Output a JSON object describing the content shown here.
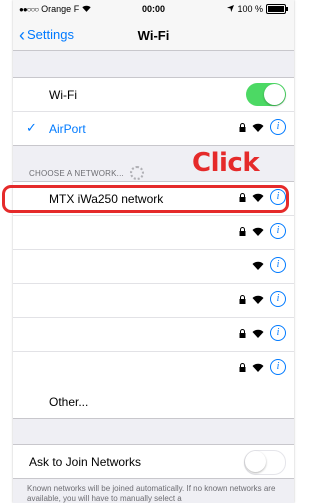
{
  "status_bar": {
    "carrier": "Orange F",
    "time": "00:00",
    "battery": "100 %",
    "battery_level": 1.0
  },
  "nav": {
    "back_label": "Settings",
    "title": "Wi-Fi"
  },
  "wifi_group": {
    "wifi_label": "Wi-Fi",
    "wifi_enabled": true,
    "connected_network": "AirPort"
  },
  "networks_header": "CHOOSE A NETWORK...",
  "networks": [
    {
      "name": "MTX iWa250 network",
      "secured": true
    },
    {
      "name": "",
      "secured": true
    },
    {
      "name": "",
      "secured": false
    },
    {
      "name": "",
      "secured": true
    },
    {
      "name": "",
      "secured": true
    },
    {
      "name": "",
      "secured": true
    }
  ],
  "other_label": "Other...",
  "ask_to_join": {
    "label": "Ask to Join Networks",
    "enabled": false
  },
  "footer": "Known networks will be joined automatically. If no known networks are available, you will have to manually select a",
  "annotation": {
    "text": "Click",
    "color": "#e52a2a"
  },
  "colors": {
    "accent": "#007aff",
    "toggle_on": "#4cd964"
  },
  "icons": {
    "lock": "lock-icon",
    "wifi": "wifi-signal-icon",
    "info": "info-icon"
  }
}
